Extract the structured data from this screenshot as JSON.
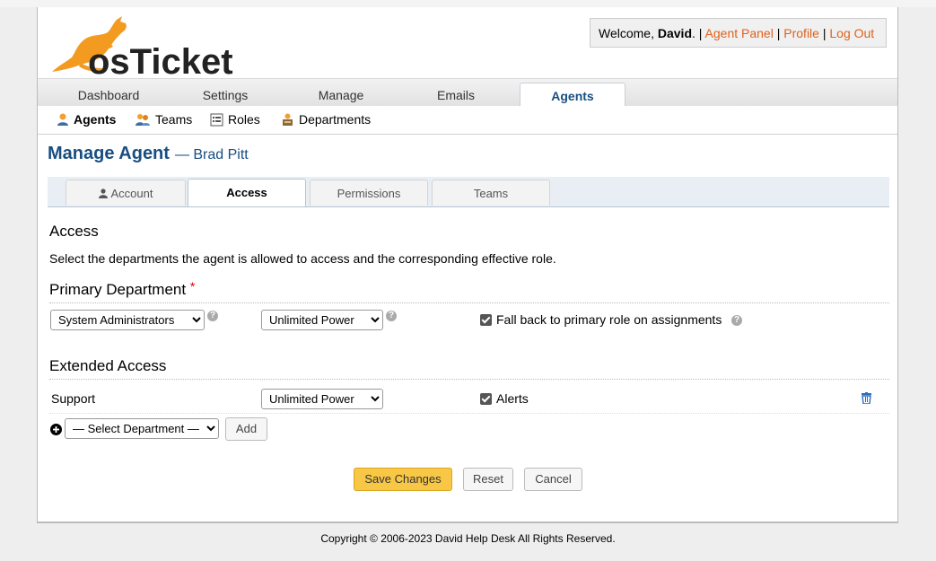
{
  "header": {
    "logo_text": "osTicket",
    "welcome_prefix": "Welcome, ",
    "user_name": "David",
    "welcome_suffix": ". | ",
    "agent_panel": "Agent Panel",
    "sep": " | ",
    "profile": "Profile",
    "logout": "Log Out"
  },
  "nav": {
    "items": [
      {
        "label": "Dashboard"
      },
      {
        "label": "Settings"
      },
      {
        "label": "Manage"
      },
      {
        "label": "Emails"
      },
      {
        "label": "Agents"
      }
    ],
    "active": "Agents"
  },
  "subnav": {
    "items": [
      {
        "label": "Agents",
        "icon": "agent-icon"
      },
      {
        "label": "Teams",
        "icon": "teams-icon"
      },
      {
        "label": "Roles",
        "icon": "roles-icon"
      },
      {
        "label": "Departments",
        "icon": "departments-icon"
      }
    ]
  },
  "page": {
    "title": "Manage Agent",
    "subtitle": "— Brad Pitt"
  },
  "tabs": [
    {
      "label": "Account",
      "icon": "user-icon"
    },
    {
      "label": "Access"
    },
    {
      "label": "Permissions"
    },
    {
      "label": "Teams"
    }
  ],
  "access": {
    "heading": "Access",
    "description": "Select the departments the agent is allowed to access and the corresponding effective role."
  },
  "primary": {
    "heading": "Primary Department",
    "required_mark": "*",
    "department": "System Administrators",
    "role": "Unlimited Power",
    "fallback_label": "Fall back to primary role on assignments",
    "fallback_checked": true
  },
  "extended": {
    "heading": "Extended Access",
    "rows": [
      {
        "department": "Support",
        "role": "Unlimited Power",
        "alerts_label": "Alerts",
        "alerts_checked": true
      }
    ],
    "select_placeholder": "— Select Department —",
    "add_label": "Add"
  },
  "buttons": {
    "save": "Save Changes",
    "reset": "Reset",
    "cancel": "Cancel"
  },
  "footer": {
    "copyright": "Copyright © 2006-2023 David Help Desk All Rights Reserved."
  },
  "colors": {
    "brand_orange": "#f39a21",
    "link": "#e0611b",
    "heading_blue": "#184e81",
    "save_button": "#f8c745"
  }
}
